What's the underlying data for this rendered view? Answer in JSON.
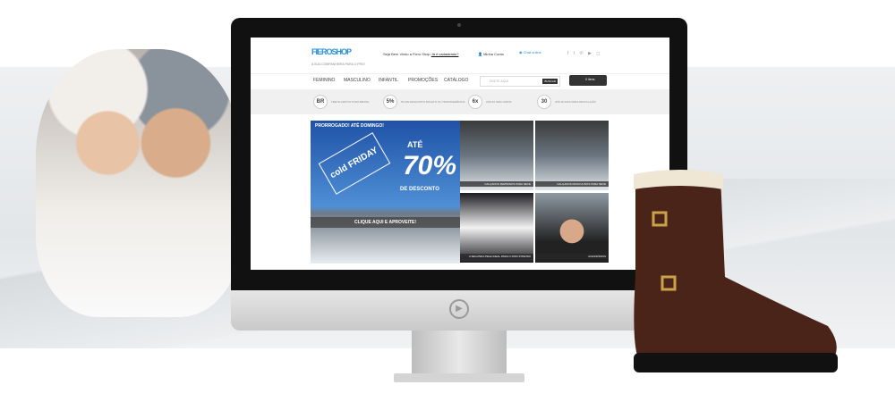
{
  "site": {
    "logo": "FIERO",
    "logo_suffix": "SHOP",
    "tagline": "A SUA COMPANHEIRA PARA O FRIO",
    "welcome": "Seja Bem Vindo a Fiero Shop",
    "register_link": "Já é cadastrado?",
    "account": "Minha Conta",
    "chat": "Chat online",
    "social": "f t ✆ ▶ ◻",
    "nav": [
      "FEMININO",
      "MASCULINO",
      "INFANTIL",
      "PROMOÇÕES",
      "CATÁLOGO"
    ],
    "search_placeholder": "DIGITE AQUI",
    "search_button": "BUSCAR",
    "cart": "0 Itens",
    "perks": [
      {
        "icon": "BR",
        "text": "FRETE GRÁTIS TODO BRASIL"
      },
      {
        "icon": "5%",
        "text": "5% DE DESCONTO BOLETO OU TRANSFERÊNCIA"
      },
      {
        "icon": "6x",
        "text": "ATÉ 6X SEM JUROS"
      },
      {
        "icon": "30",
        "text": "ATÉ 30 DIAS PARA DEVOLUÇÃO"
      }
    ],
    "hero": {
      "prorrogado": "PRORROGADO! ATÉ DOMINGO!",
      "tag": "cold FRIDAY",
      "ate": "ATÉ",
      "percent": "70%",
      "desconto": "DE DESCONTO",
      "cta": "CLIQUE AQUI E APROVEITE!"
    },
    "tiles": [
      "CALÇADOS FEMININOS PARA NEVE",
      "CALÇADOS MASCULINOS PARA NEVE",
      "A SEGUNDA PELE IDEAL PARA O FRIO INTENSO",
      "ACESSÓRIOS"
    ]
  }
}
